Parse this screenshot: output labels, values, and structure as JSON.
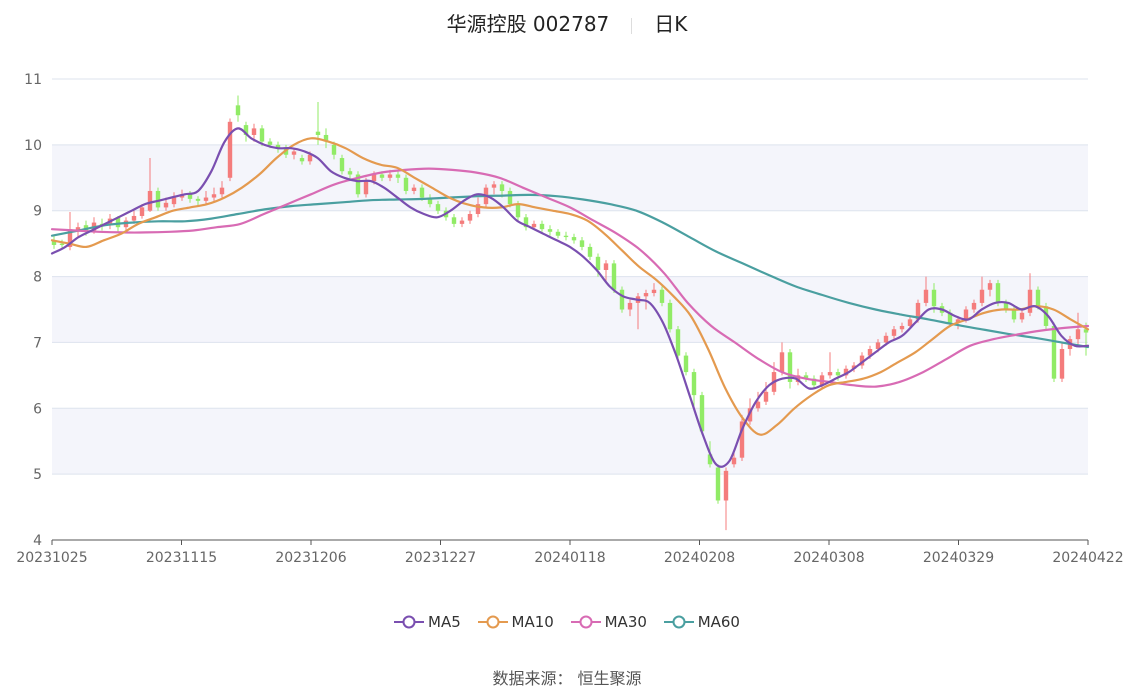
{
  "title": {
    "stock": "华源控股 002787",
    "period": "日K"
  },
  "colors": {
    "up": "#f47c7c",
    "down": "#91eb66",
    "ma5": "#7a4fb0",
    "ma10": "#e49a4f",
    "ma30": "#d86bb4",
    "ma60": "#4a9fa0",
    "band": "#f4f5fb",
    "grid": "#dde3ee"
  },
  "legend": [
    {
      "key": "ma5",
      "label": "MA5"
    },
    {
      "key": "ma10",
      "label": "MA10"
    },
    {
      "key": "ma30",
      "label": "MA30"
    },
    {
      "key": "ma60",
      "label": "MA60"
    }
  ],
  "source": "数据来源： 恒生聚源",
  "chart_data": {
    "type": "candlestick",
    "ylim": [
      4,
      11
    ],
    "yticks": [
      4,
      5,
      6,
      7,
      8,
      9,
      10,
      11
    ],
    "x_ticks": [
      "20231025",
      "20231115",
      "20231206",
      "20231227",
      "20240118",
      "20240208",
      "20240308",
      "20240329",
      "20240422"
    ],
    "x_tick_index": [
      0,
      20,
      40,
      60,
      80,
      100,
      120,
      140,
      160
    ],
    "candles": [
      [
        8.55,
        8.48,
        8.62,
        8.42
      ],
      [
        8.5,
        8.48,
        8.56,
        8.44
      ],
      [
        8.45,
        8.72,
        8.98,
        8.4
      ],
      [
        8.7,
        8.75,
        8.82,
        8.6
      ],
      [
        8.78,
        8.7,
        8.85,
        8.62
      ],
      [
        8.7,
        8.82,
        8.9,
        8.65
      ],
      [
        8.8,
        8.78,
        8.88,
        8.7
      ],
      [
        8.78,
        8.88,
        8.95,
        8.72
      ],
      [
        8.9,
        8.75,
        8.92,
        8.68
      ],
      [
        8.75,
        8.85,
        8.9,
        8.7
      ],
      [
        8.85,
        8.92,
        9.0,
        8.8
      ],
      [
        8.92,
        9.05,
        9.1,
        8.88
      ],
      [
        9.0,
        9.3,
        9.8,
        8.98
      ],
      [
        9.3,
        9.05,
        9.35,
        9.0
      ],
      [
        9.05,
        9.12,
        9.2,
        9.0
      ],
      [
        9.1,
        9.2,
        9.28,
        9.05
      ],
      [
        9.2,
        9.25,
        9.32,
        9.15
      ],
      [
        9.25,
        9.18,
        9.3,
        9.12
      ],
      [
        9.18,
        9.15,
        9.22,
        9.08
      ],
      [
        9.15,
        9.2,
        9.3,
        9.1
      ],
      [
        9.2,
        9.25,
        9.35,
        9.15
      ],
      [
        9.25,
        9.35,
        9.45,
        9.2
      ],
      [
        9.5,
        10.35,
        10.4,
        9.45
      ],
      [
        10.6,
        10.45,
        10.75,
        10.35
      ],
      [
        10.3,
        10.15,
        10.35,
        10.05
      ],
      [
        10.15,
        10.25,
        10.32,
        10.05
      ],
      [
        10.25,
        10.05,
        10.3,
        9.98
      ],
      [
        10.05,
        10.0,
        10.1,
        9.95
      ],
      [
        10.0,
        9.95,
        10.05,
        9.88
      ],
      [
        9.95,
        9.85,
        10.0,
        9.8
      ],
      [
        9.85,
        9.9,
        9.95,
        9.78
      ],
      [
        9.8,
        9.75,
        9.85,
        9.7
      ],
      [
        9.75,
        9.85,
        9.9,
        9.7
      ],
      [
        10.2,
        10.15,
        10.65,
        10.0
      ],
      [
        10.15,
        10.05,
        10.25,
        9.95
      ],
      [
        10.0,
        9.85,
        10.05,
        9.78
      ],
      [
        9.8,
        9.6,
        9.85,
        9.55
      ],
      [
        9.6,
        9.55,
        9.65,
        9.45
      ],
      [
        9.55,
        9.25,
        9.6,
        9.2
      ],
      [
        9.25,
        9.45,
        9.5,
        9.2
      ],
      [
        9.45,
        9.55,
        9.6,
        9.4
      ],
      [
        9.55,
        9.5,
        9.6,
        9.45
      ],
      [
        9.5,
        9.55,
        9.62,
        9.45
      ],
      [
        9.55,
        9.5,
        9.6,
        9.42
      ],
      [
        9.5,
        9.3,
        9.55,
        9.25
      ],
      [
        9.3,
        9.35,
        9.4,
        9.25
      ],
      [
        9.35,
        9.2,
        9.4,
        9.15
      ],
      [
        9.2,
        9.1,
        9.25,
        9.05
      ],
      [
        9.1,
        9.0,
        9.15,
        8.95
      ],
      [
        9.0,
        8.9,
        9.05,
        8.85
      ],
      [
        8.9,
        8.8,
        8.95,
        8.75
      ],
      [
        8.8,
        8.85,
        8.9,
        8.75
      ],
      [
        8.85,
        8.95,
        9.0,
        8.8
      ],
      [
        8.95,
        9.1,
        9.2,
        8.9
      ],
      [
        9.1,
        9.35,
        9.4,
        9.05
      ],
      [
        9.35,
        9.4,
        9.45,
        9.25
      ],
      [
        9.4,
        9.3,
        9.45,
        9.2
      ],
      [
        9.3,
        9.1,
        9.35,
        9.05
      ],
      [
        9.1,
        8.9,
        9.15,
        8.85
      ],
      [
        8.9,
        8.75,
        8.95,
        8.7
      ],
      [
        8.75,
        8.8,
        8.85,
        8.72
      ],
      [
        8.8,
        8.72,
        8.85,
        8.68
      ],
      [
        8.72,
        8.68,
        8.78,
        8.62
      ],
      [
        8.68,
        8.62,
        8.72,
        8.58
      ],
      [
        8.62,
        8.6,
        8.68,
        8.55
      ],
      [
        8.6,
        8.55,
        8.65,
        8.5
      ],
      [
        8.55,
        8.45,
        8.6,
        8.4
      ],
      [
        8.45,
        8.3,
        8.5,
        8.25
      ],
      [
        8.3,
        8.1,
        8.35,
        8.0
      ],
      [
        8.1,
        8.2,
        8.25,
        7.9
      ],
      [
        8.2,
        7.8,
        8.25,
        7.75
      ],
      [
        7.8,
        7.5,
        7.85,
        7.45
      ],
      [
        7.5,
        7.6,
        7.65,
        7.4
      ],
      [
        7.6,
        7.7,
        7.75,
        7.2
      ],
      [
        7.7,
        7.75,
        7.8,
        7.5
      ],
      [
        7.75,
        7.8,
        7.9,
        7.7
      ],
      [
        7.8,
        7.6,
        7.85,
        7.55
      ],
      [
        7.6,
        7.2,
        7.65,
        7.15
      ],
      [
        7.2,
        6.8,
        7.25,
        6.75
      ],
      [
        6.8,
        6.55,
        6.85,
        6.5
      ],
      [
        6.55,
        6.2,
        6.6,
        6.0
      ],
      [
        6.2,
        5.65,
        6.25,
        5.6
      ],
      [
        5.3,
        5.15,
        5.5,
        5.1
      ],
      [
        5.1,
        4.6,
        5.15,
        4.55
      ],
      [
        4.6,
        5.05,
        5.1,
        4.15
      ],
      [
        5.15,
        5.25,
        5.35,
        5.1
      ],
      [
        5.25,
        5.8,
        5.9,
        5.2
      ],
      [
        5.8,
        6.0,
        6.15,
        5.75
      ],
      [
        6.0,
        6.1,
        6.25,
        5.95
      ],
      [
        6.1,
        6.25,
        6.4,
        6.05
      ],
      [
        6.25,
        6.55,
        6.7,
        6.2
      ],
      [
        6.55,
        6.85,
        7.0,
        6.5
      ],
      [
        6.85,
        6.4,
        6.9,
        6.3
      ],
      [
        6.4,
        6.5,
        6.6,
        6.35
      ],
      [
        6.5,
        6.45,
        6.55,
        6.4
      ],
      [
        6.45,
        6.35,
        6.5,
        6.3
      ],
      [
        6.35,
        6.5,
        6.55,
        6.3
      ],
      [
        6.5,
        6.55,
        6.85,
        6.45
      ],
      [
        6.55,
        6.5,
        6.6,
        6.42
      ],
      [
        6.5,
        6.6,
        6.65,
        6.45
      ],
      [
        6.6,
        6.65,
        6.7,
        6.55
      ],
      [
        6.65,
        6.8,
        6.85,
        6.6
      ],
      [
        6.8,
        6.9,
        6.95,
        6.75
      ],
      [
        6.9,
        7.0,
        7.05,
        6.85
      ],
      [
        7.0,
        7.1,
        7.15,
        6.95
      ],
      [
        7.1,
        7.2,
        7.25,
        7.05
      ],
      [
        7.2,
        7.25,
        7.3,
        7.15
      ],
      [
        7.25,
        7.35,
        7.4,
        7.2
      ],
      [
        7.35,
        7.6,
        7.65,
        7.3
      ],
      [
        7.6,
        7.8,
        8.0,
        7.55
      ],
      [
        7.8,
        7.55,
        7.9,
        7.45
      ],
      [
        7.55,
        7.45,
        7.6,
        7.4
      ],
      [
        7.45,
        7.3,
        7.5,
        7.25
      ],
      [
        7.3,
        7.35,
        7.4,
        7.2
      ],
      [
        7.35,
        7.5,
        7.55,
        7.3
      ],
      [
        7.5,
        7.6,
        7.65,
        7.45
      ],
      [
        7.6,
        7.8,
        8.0,
        7.55
      ],
      [
        7.8,
        7.9,
        7.95,
        7.7
      ],
      [
        7.9,
        7.6,
        7.95,
        7.55
      ],
      [
        7.6,
        7.5,
        7.65,
        7.45
      ],
      [
        7.5,
        7.35,
        7.55,
        7.3
      ],
      [
        7.35,
        7.45,
        7.5,
        7.3
      ],
      [
        7.45,
        7.8,
        8.05,
        7.4
      ],
      [
        7.8,
        7.55,
        7.85,
        7.5
      ],
      [
        7.55,
        7.25,
        7.6,
        7.2
      ],
      [
        7.25,
        6.45,
        7.3,
        6.4
      ],
      [
        6.45,
        6.9,
        7.0,
        6.4
      ],
      [
        6.9,
        7.05,
        7.1,
        6.8
      ],
      [
        7.05,
        7.2,
        7.45,
        6.95
      ],
      [
        7.2,
        7.15,
        7.3,
        6.8
      ]
    ],
    "ma5": [
      8.35,
      8.45,
      8.6,
      8.7,
      8.8,
      8.9,
      9.0,
      9.1,
      9.15,
      9.2,
      9.25,
      9.3,
      9.6,
      10.05,
      10.25,
      10.1,
      10.0,
      9.95,
      9.95,
      9.9,
      9.8,
      9.6,
      9.5,
      9.45,
      9.45,
      9.35,
      9.2,
      9.05,
      8.95,
      8.9,
      9.0,
      9.15,
      9.25,
      9.2,
      9.05,
      8.85,
      8.75,
      8.65,
      8.55,
      8.45,
      8.3,
      8.1,
      7.85,
      7.7,
      7.65,
      7.6,
      7.3,
      6.8,
      6.2,
      5.6,
      5.15,
      5.2,
      5.7,
      6.1,
      6.35,
      6.45,
      6.45,
      6.3,
      6.35,
      6.45,
      6.55,
      6.7,
      6.85,
      7.0,
      7.1,
      7.3,
      7.5,
      7.5,
      7.4,
      7.35,
      7.5,
      7.6,
      7.6,
      7.5,
      7.55,
      7.4,
      7.1,
      6.95,
      6.95
    ],
    "ma10": [
      8.55,
      8.5,
      8.45,
      8.55,
      8.65,
      8.8,
      8.9,
      9.0,
      9.05,
      9.1,
      9.2,
      9.35,
      9.55,
      9.8,
      10.0,
      10.1,
      10.05,
      9.95,
      9.8,
      9.7,
      9.65,
      9.5,
      9.35,
      9.2,
      9.1,
      9.05,
      9.05,
      9.1,
      9.05,
      9.0,
      8.95,
      8.85,
      8.65,
      8.4,
      8.15,
      7.95,
      7.7,
      7.4,
      6.9,
      6.3,
      5.85,
      5.6,
      5.75,
      6.0,
      6.2,
      6.35,
      6.4,
      6.45,
      6.55,
      6.7,
      6.85,
      7.05,
      7.25,
      7.35,
      7.45,
      7.5,
      7.5,
      7.55,
      7.5,
      7.35,
      7.2
    ],
    "ma30": [
      8.72,
      8.7,
      8.68,
      8.67,
      8.67,
      8.68,
      8.7,
      8.75,
      8.8,
      8.95,
      9.1,
      9.25,
      9.4,
      9.5,
      9.58,
      9.62,
      9.64,
      9.62,
      9.58,
      9.5,
      9.35,
      9.2,
      9.05,
      8.85,
      8.65,
      8.4,
      8.05,
      7.6,
      7.25,
      7.0,
      6.75,
      6.55,
      6.45,
      6.4,
      6.35,
      6.33,
      6.4,
      6.55,
      6.75,
      6.95,
      7.05,
      7.12,
      7.18,
      7.22,
      7.25
    ],
    "ma60": [
      8.62,
      8.7,
      8.78,
      8.82,
      8.84,
      8.84,
      8.88,
      8.95,
      9.02,
      9.07,
      9.1,
      9.13,
      9.16,
      9.17,
      9.18,
      9.2,
      9.22,
      9.23,
      9.24,
      9.22,
      9.17,
      9.1,
      9.0,
      8.82,
      8.6,
      8.38,
      8.2,
      8.02,
      7.85,
      7.72,
      7.6,
      7.5,
      7.42,
      7.35,
      7.27,
      7.2,
      7.13,
      7.07,
      7.0,
      6.93
    ]
  }
}
